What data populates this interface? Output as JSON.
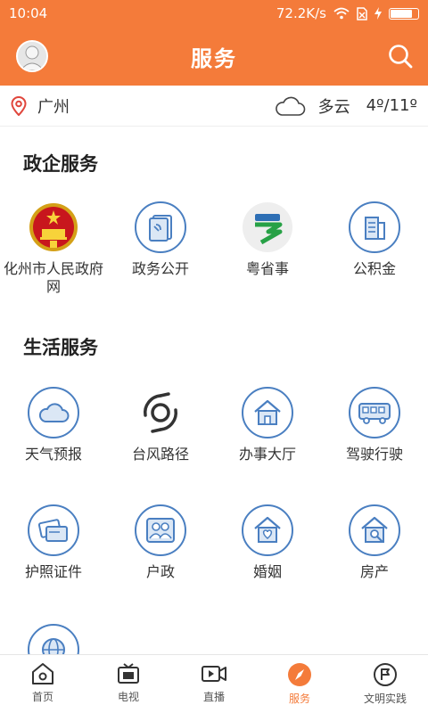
{
  "status_bar": {
    "time": "10:04",
    "net_speed": "72.2K/s"
  },
  "header": {
    "title": "服务"
  },
  "weather": {
    "city": "广州",
    "condition": "多云",
    "temperature": "4º/11º"
  },
  "sections": {
    "gov_title": "政企服务",
    "life_title": "生活服务"
  },
  "gov_services": [
    {
      "label": "化州市人民政府网",
      "icon": "national-emblem-icon"
    },
    {
      "label": "政务公开",
      "icon": "document-icon"
    },
    {
      "label": "粤省事",
      "icon": "yue-app-icon"
    },
    {
      "label": "公积金",
      "icon": "building-icon"
    }
  ],
  "life_services": [
    {
      "label": "天气预报",
      "icon": "cloud-icon"
    },
    {
      "label": "台风路径",
      "icon": "typhoon-icon"
    },
    {
      "label": "办事大厅",
      "icon": "house-icon"
    },
    {
      "label": "驾驶行驶",
      "icon": "bus-icon"
    },
    {
      "label": "护照证件",
      "icon": "cards-icon"
    },
    {
      "label": "户政",
      "icon": "people-icon"
    },
    {
      "label": "婚姻",
      "icon": "heart-house-icon"
    },
    {
      "label": "房产",
      "icon": "house-search-icon"
    }
  ],
  "bottom_nav": [
    {
      "label": "首页",
      "icon": "home-icon"
    },
    {
      "label": "电视",
      "icon": "tv-icon"
    },
    {
      "label": "直播",
      "icon": "video-icon"
    },
    {
      "label": "服务",
      "icon": "compass-icon",
      "active": true
    },
    {
      "label": "文明实践",
      "icon": "flag-icon"
    }
  ],
  "colors": {
    "brand": "#f47b3a",
    "icon_blue": "#4a7fc1"
  }
}
